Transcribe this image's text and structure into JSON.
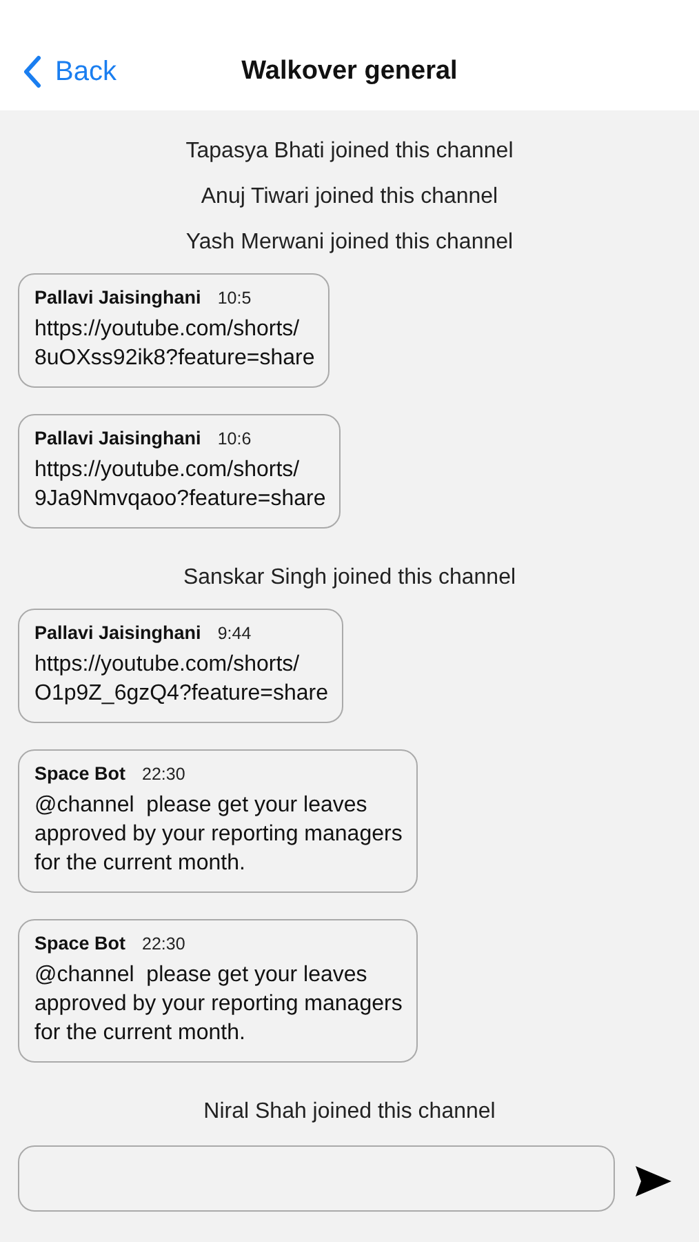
{
  "header": {
    "back_label": "Back",
    "title": "Walkover general"
  },
  "feed": [
    {
      "kind": "event",
      "text": "Tapasya Bhati joined this channel"
    },
    {
      "kind": "event",
      "text": "Anuj Tiwari joined this channel"
    },
    {
      "kind": "event",
      "text": "Yash Merwani joined this channel"
    },
    {
      "kind": "message",
      "sender": "Pallavi Jaisinghani",
      "time": "10:5",
      "lines": [
        "https://youtube.com/shorts/",
        "8uOXss92ik8?feature=share"
      ]
    },
    {
      "kind": "message",
      "sender": "Pallavi Jaisinghani",
      "time": "10:6",
      "lines": [
        "https://youtube.com/shorts/",
        "9Ja9Nmvqaoo?feature=share"
      ]
    },
    {
      "kind": "event",
      "text": "Sanskar Singh joined this channel"
    },
    {
      "kind": "message",
      "sender": "Pallavi Jaisinghani",
      "time": "9:44",
      "lines": [
        "https://youtube.com/shorts/",
        "O1p9Z_6gzQ4?feature=share"
      ]
    },
    {
      "kind": "message",
      "sender": "Space Bot",
      "time": "22:30",
      "lines": [
        "@channel  please get your leaves",
        "approved by your reporting managers",
        "for the current month."
      ]
    },
    {
      "kind": "message",
      "sender": "Space Bot",
      "time": "22:30",
      "lines": [
        "@channel  please get your leaves",
        "approved by your reporting managers",
        "for the current month."
      ]
    },
    {
      "kind": "event",
      "text": "Niral Shah joined this channel"
    }
  ]
}
